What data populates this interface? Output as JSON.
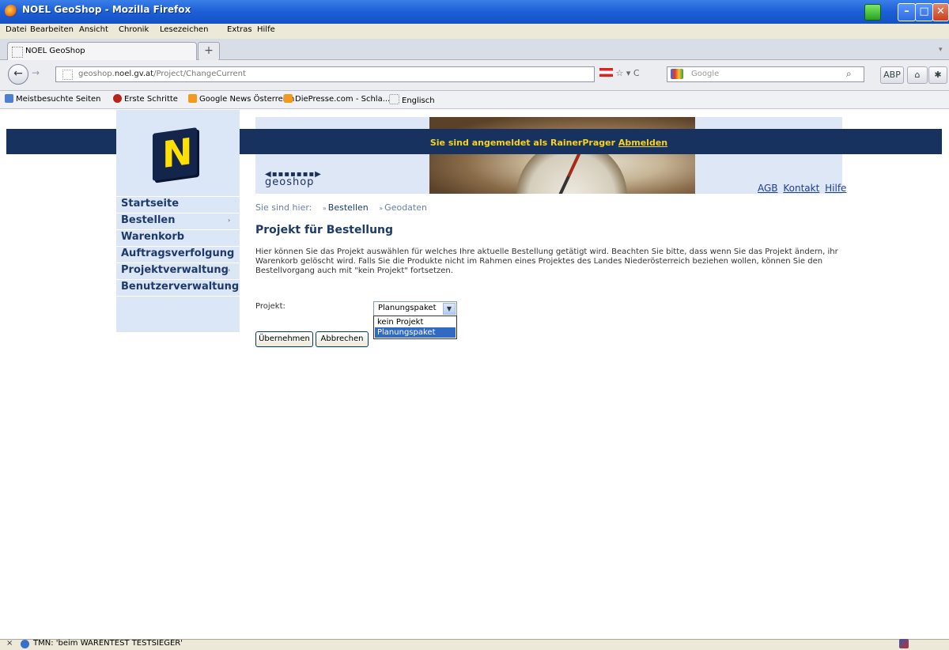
{
  "window": {
    "title": "NOEL GeoShop - Mozilla Firefox"
  },
  "menu": [
    "Datei",
    "Bearbeiten",
    "Ansicht",
    "Chronik",
    "Lesezeichen",
    "Extras",
    "Hilfe"
  ],
  "tab": {
    "label": "NOEL GeoShop",
    "new_tab": "+"
  },
  "address": {
    "host_prefix": "geoshop.",
    "host_main": "noel.gv.at",
    "path": "/Project/ChangeCurrent"
  },
  "search": {
    "placeholder": "Google"
  },
  "bookmarks": [
    "Meistbesuchte Seiten",
    "Erste Schritte",
    "Google News Österreich",
    "DiePresse.com - Schla...",
    "Englisch"
  ],
  "header": {
    "logo_letter": "N",
    "logged_in_text": "Sie sind angemeldet als RainerPrager",
    "logout_link": "Abmelden",
    "geoshop_logo": "geoshop",
    "links": [
      "AGB",
      "Kontakt",
      "Hilfe"
    ]
  },
  "sidebar": {
    "items": [
      {
        "label": "Startseite",
        "arrow": ""
      },
      {
        "label": "Bestellen",
        "arrow": "›"
      },
      {
        "label": "Warenkorb",
        "arrow": ""
      },
      {
        "label": "Auftragsverfolgung",
        "arrow": ""
      },
      {
        "label": "Projektverwaltung",
        "arrow": "›"
      },
      {
        "label": "Benutzerverwaltung",
        "arrow": "›"
      }
    ]
  },
  "breadcrumb": {
    "prefix": "Sie sind hier:",
    "items": [
      "Bestellen",
      "Geodaten"
    ],
    "separator": "»"
  },
  "main": {
    "heading": "Projekt für Bestellung",
    "intro": "Hier können Sie das Projekt auswählen für welches Ihre aktuelle Bestellung getätigt wird. Beachten Sie bitte, dass wenn Sie das Projekt ändern, ihr Warenkorb gelöscht wird. Falls Sie die Produkte nicht im Rahmen eines Projektes des Landes Niederösterreich beziehen wollen, können Sie den Bestellvorgang auch mit \"kein Projekt\" fortsetzen.",
    "project_label": "Projekt:",
    "project_value": "Planungspaket",
    "project_options": [
      "kein Projekt",
      "Planungspaket"
    ],
    "selected_option": "Planungspaket",
    "accept_button": "Übernehmen",
    "cancel_button": "Abbrechen"
  },
  "status": {
    "text": "TMN: 'beim WARENTEST TESTSIEGER'"
  },
  "colors": {
    "navy": "#17325e",
    "sidebar_bg": "#dbe6f6",
    "highlight": "#316ac5",
    "logged_text": "#f6d31f"
  }
}
